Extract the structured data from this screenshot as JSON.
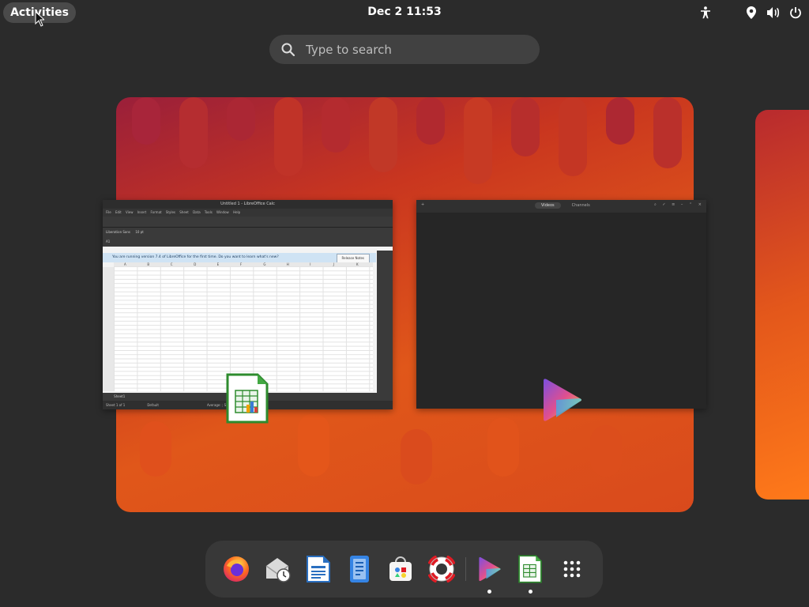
{
  "topbar": {
    "activities_label": "Activities",
    "clock": "Dec 2  11:53",
    "tray_icons": [
      "accessibility-icon",
      "location-icon",
      "volume-icon",
      "power-icon"
    ]
  },
  "search": {
    "placeholder": "Type to search"
  },
  "windows": {
    "calc": {
      "title": "Untitled 1 - LibreOffice Calc",
      "menu": "File Edit View Insert Format Styles Sheet Data Tools Window Help",
      "font_name": "Liberation Sans",
      "font_size": "10 pt",
      "cell_ref": "A1",
      "infobar_text": "You are running version 7.4 of LibreOffice for the first time. Do you want to learn what's new?",
      "infobar_button": "Release Notes",
      "columns": [
        "A",
        "B",
        "C",
        "D",
        "E",
        "F",
        "G",
        "H",
        "I",
        "J",
        "K"
      ],
      "sheet_tab": "Sheet1",
      "status_left": "Sheet 1 of 1",
      "status_mid": "Default",
      "status_right": "Average: ; Sum: 0",
      "zoom": "100%"
    },
    "video": {
      "tab_videos": "Videos",
      "tab_channels": "Channels"
    }
  },
  "dock": {
    "apps": [
      {
        "name": "firefox",
        "label": "Firefox",
        "running": false
      },
      {
        "name": "mail-clock",
        "label": "Evolution",
        "running": false
      },
      {
        "name": "writer",
        "label": "LibreOffice Writer",
        "running": false
      },
      {
        "name": "text-editor",
        "label": "Text Editor",
        "running": false
      },
      {
        "name": "software",
        "label": "Software",
        "running": false
      },
      {
        "name": "help",
        "label": "Help",
        "running": false
      },
      {
        "name": "video",
        "label": "Videos",
        "running": true
      },
      {
        "name": "calc",
        "label": "LibreOffice Calc",
        "running": true
      },
      {
        "name": "app-grid",
        "label": "Show Apps",
        "running": false
      }
    ]
  },
  "colors": {
    "panel_bg": "#2b2b2b",
    "activities_bg": "#4a4a4a",
    "dock_bg": "#383838",
    "wallpaper_top": "#9a1f3a",
    "wallpaper_mid": "#e0571a"
  }
}
